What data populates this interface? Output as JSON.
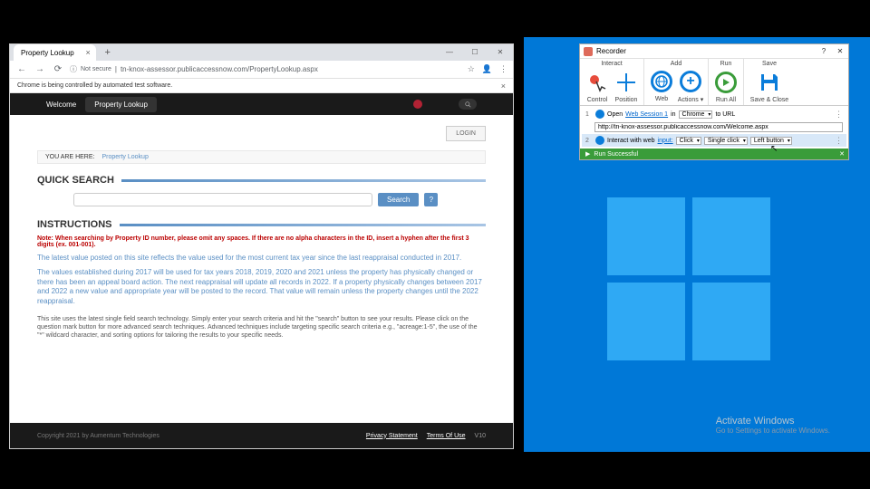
{
  "chrome": {
    "tab_title": "Property Lookup",
    "url": "tn-knox-assessor.publicaccessnow.com/PropertyLookup.aspx",
    "not_secure": "Not secure",
    "infobar": "Chrome is being controlled by automated test software."
  },
  "page": {
    "nav": {
      "welcome": "Welcome",
      "lookup": "Property Lookup"
    },
    "login": "LOGIN",
    "breadcrumb": {
      "label": "YOU ARE HERE:",
      "current": "Property Lookup"
    },
    "quick_search": "QUICK SEARCH",
    "search_btn": "Search",
    "help_btn": "?",
    "instructions": "INSTRUCTIONS",
    "note_red": "Note: When searching by Property ID number, please omit any spaces. If there are no alpha characters in the ID, insert a hyphen after the first 3 digits (ex. 001-001).",
    "note_blue1": "The latest value posted on this site reflects the value used for the most current tax year since the last reappraisal conducted in 2017.",
    "note_blue2": "The values established during 2017 will be used for tax years 2018, 2019, 2020 and 2021 unless the property has physically changed or there has been an appeal board action.  The next reappraisal will update all records in 2022.  If a property physically changes between 2017 and 2022 a new value and appropriate year will be posted to the record.  That value will remain unless the property changes until the 2022 reappraisal.",
    "note_gray": "This site uses the latest single field search technology. Simply enter your search criteria and hit the \"search\" button to see your results. Please click on the question mark button for more advanced search techniques. Advanced techniques include targeting specific search criteria e.g., \"acreage:1-5\", the use of the \"*\" wildcard character, and sorting options for tailoring the results to your specific needs.",
    "footer": {
      "copyright": "Copyright 2021 by Aumentum Technologies",
      "privacy": "Privacy Statement",
      "terms": "Terms Of Use",
      "version": "V10"
    }
  },
  "recorder": {
    "title": "Recorder",
    "groups": {
      "interact": "Interact",
      "add": "Add",
      "run": "Run",
      "save": "Save",
      "control": "Control",
      "position": "Position",
      "web": "Web",
      "actions": "Actions",
      "runall": "Run All",
      "saveclose": "Save & Close"
    },
    "step1": {
      "num": "1",
      "open": "Open",
      "session": "Web Session 1",
      "in": "in",
      "browser": "Chrome",
      "to_url": "to URL",
      "url": "http://tn-knox-assessor.publicaccessnow.com/Welcome.aspx"
    },
    "step2": {
      "num": "2",
      "interact": "Interact with web",
      "target": "input:",
      "action": "Click",
      "clicktype": "Single click",
      "button": "Left button"
    },
    "status": "Run Successful"
  },
  "desktop": {
    "activate_title": "Activate Windows",
    "activate_sub": "Go to Settings to activate Windows."
  }
}
